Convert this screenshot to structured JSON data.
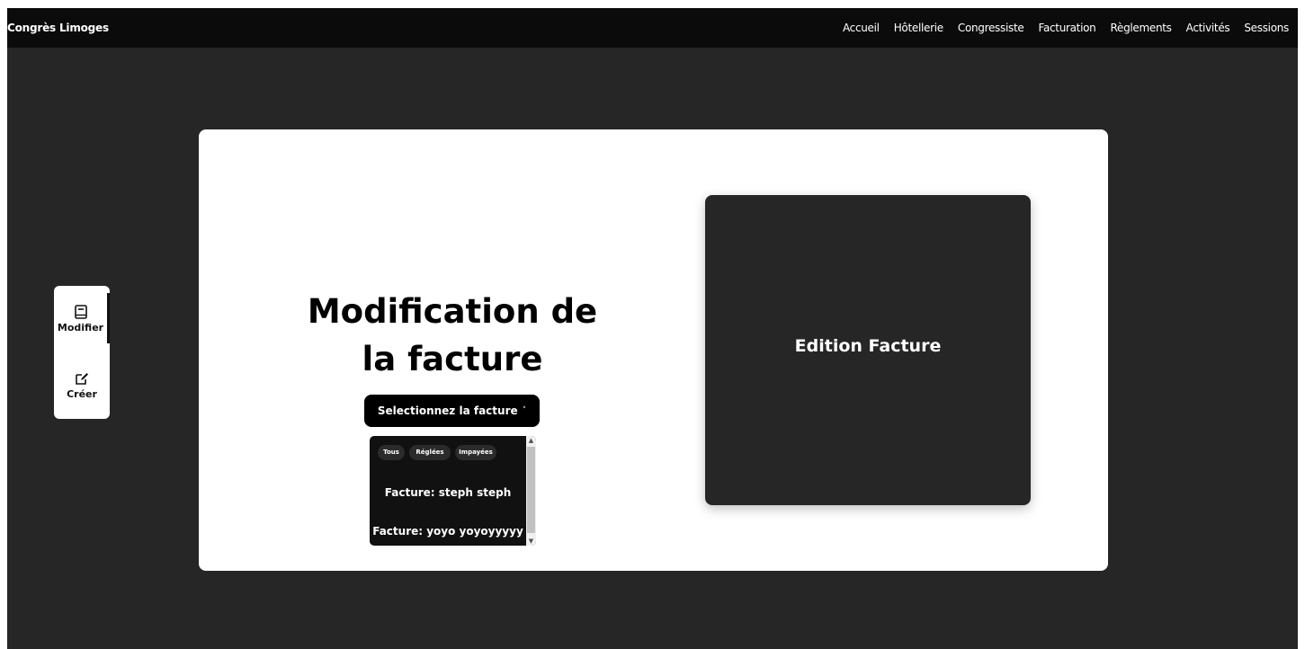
{
  "navbar": {
    "brand": "Congrès Limoges",
    "links": [
      "Accueil",
      "Hôtellerie",
      "Congressiste",
      "Facturation",
      "Règlements",
      "Activités",
      "Sessions"
    ]
  },
  "side_panel": {
    "items": [
      {
        "label": "Modifier",
        "icon": "book-icon",
        "active": true
      },
      {
        "label": "Créer",
        "icon": "edit-icon",
        "active": false
      }
    ]
  },
  "main": {
    "heading": "Modification de\nla facture",
    "select_label": "Selectionnez la facture",
    "select_chevron": "˅",
    "filters": [
      "Tous",
      "Réglées",
      "Impayées"
    ],
    "invoices": [
      "Facture: steph steph",
      "Facture: yoyo yoyoyyyyy"
    ],
    "edition_title": "Edition Facture"
  },
  "colors": {
    "page_bg": "#262626",
    "navbar_bg": "#0b0b0b",
    "card_bg": "#ffffff",
    "button_bg": "#000000",
    "text_light": "#ffffff"
  }
}
